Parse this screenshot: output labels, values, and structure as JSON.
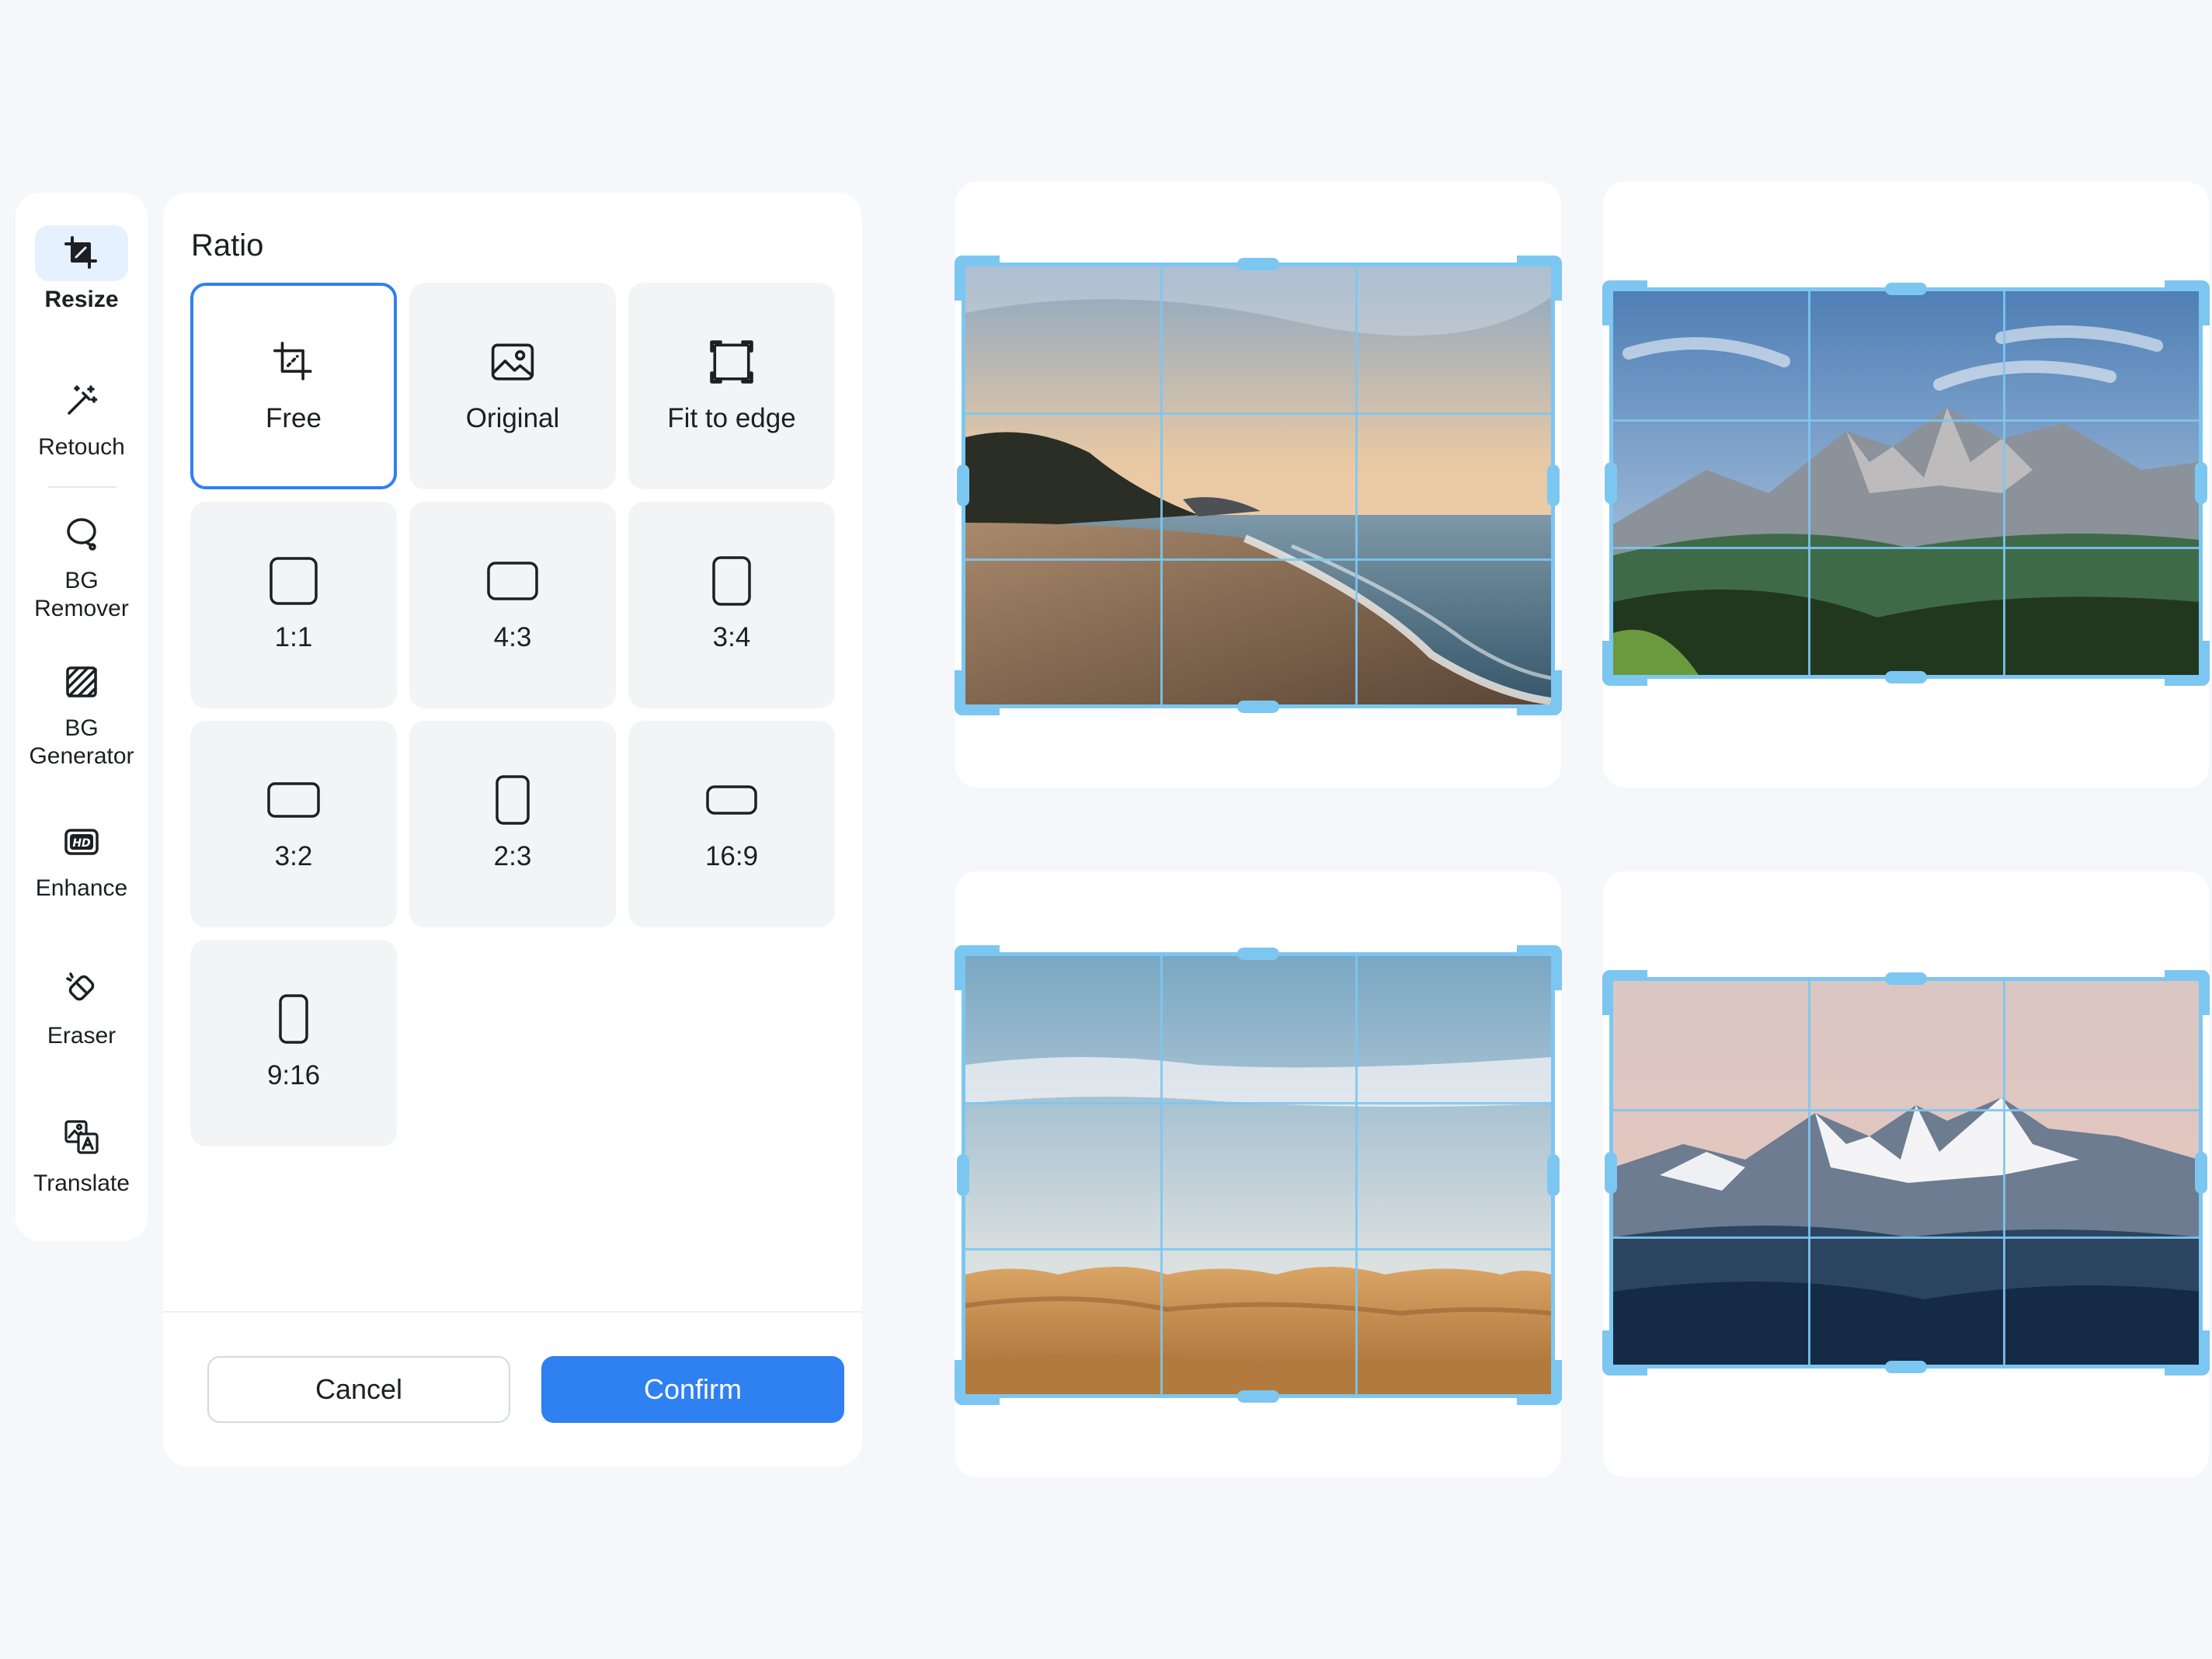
{
  "sidebar": {
    "items": [
      {
        "label": "Resize",
        "icon": "crop-resize-icon",
        "active": true
      },
      {
        "label": "Retouch",
        "icon": "magic-wand-icon"
      },
      {
        "label": "BG\nRemover",
        "icon": "lasso-icon"
      },
      {
        "label": "BG\nGenerator",
        "icon": "hatched-square-icon"
      },
      {
        "label": "Enhance",
        "icon": "hd-icon"
      },
      {
        "label": "Eraser",
        "icon": "eraser-icon"
      },
      {
        "label": "Translate",
        "icon": "translate-icon"
      }
    ]
  },
  "panel": {
    "title": "Ratio",
    "options": [
      {
        "label": "Free",
        "icon": "free-crop-icon",
        "selected": true
      },
      {
        "label": "Original",
        "icon": "image-icon"
      },
      {
        "label": "Fit to edge",
        "icon": "fit-to-edge-icon"
      },
      {
        "label": "1:1",
        "icon": "ratio-1-1-icon"
      },
      {
        "label": "4:3",
        "icon": "ratio-4-3-icon"
      },
      {
        "label": "3:4",
        "icon": "ratio-3-4-icon"
      },
      {
        "label": "3:2",
        "icon": "ratio-3-2-icon"
      },
      {
        "label": "2:3",
        "icon": "ratio-2-3-icon"
      },
      {
        "label": "16:9",
        "icon": "ratio-16-9-icon"
      },
      {
        "label": "9:16",
        "icon": "ratio-9-16-icon"
      }
    ],
    "cancel_label": "Cancel",
    "confirm_label": "Confirm"
  },
  "previews": [
    {
      "scene": "beach-sunset",
      "icon": "beach-photo"
    },
    {
      "scene": "green-mountains",
      "icon": "mountain-photo"
    },
    {
      "scene": "desert-dunes",
      "icon": "desert-photo"
    },
    {
      "scene": "snowy-mountains",
      "icon": "snow-mountain-photo"
    }
  ],
  "colors": {
    "accent": "#2f80f0",
    "crop_frame": "#7cc6f2",
    "background": "#f6f7fa",
    "tile": "#f3f4f6"
  }
}
